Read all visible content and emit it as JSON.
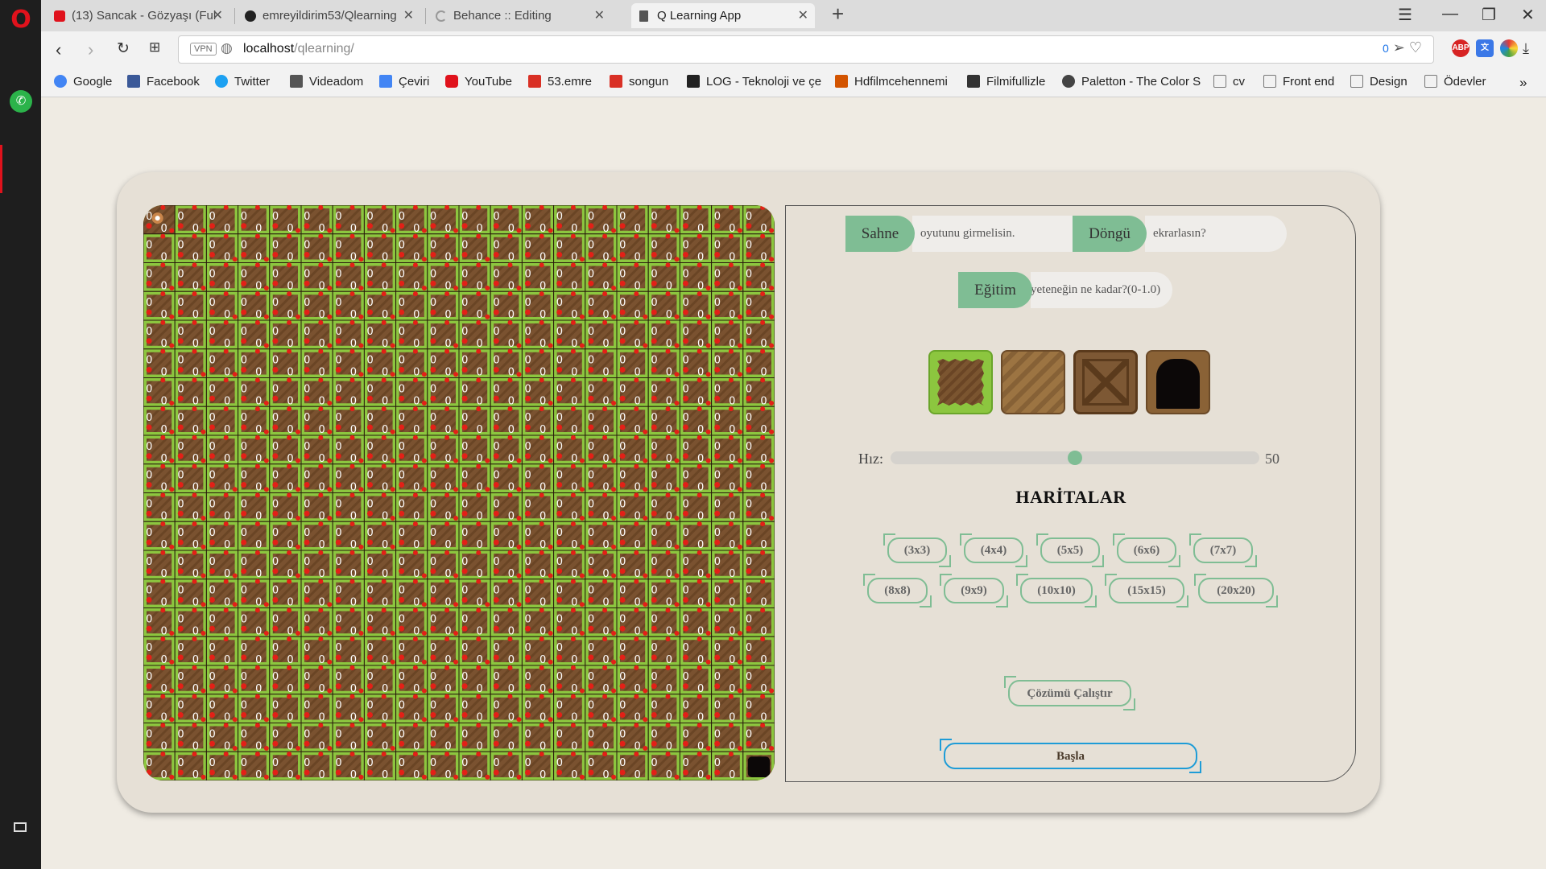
{
  "browser": {
    "tabs": [
      {
        "label": "(13) Sancak - Gözyaşı (Ful",
        "icon": "youtube-icon",
        "color": "#e0121c"
      },
      {
        "label": "emreyildirim53/Qlearning",
        "icon": "github-icon",
        "color": "#222222"
      },
      {
        "label": "Behance :: Editing",
        "icon": "loading-icon",
        "color": "#999999"
      },
      {
        "label": "Q Learning App",
        "icon": "page-icon",
        "color": "#555555"
      }
    ],
    "url_host": "localhost",
    "url_path": "/qlearning/",
    "vpn_label": "VPN",
    "adblock_count": "0",
    "bookmarks": [
      {
        "label": "Google",
        "color": "#4285f4"
      },
      {
        "label": "Facebook",
        "color": "#3b5998"
      },
      {
        "label": "Twitter",
        "color": "#1da1f2"
      },
      {
        "label": "Videadom",
        "color": "#555555"
      },
      {
        "label": "Çeviri",
        "color": "#4285f4"
      },
      {
        "label": "YouTube",
        "color": "#e0121c"
      },
      {
        "label": "53.emre",
        "color": "#d93025"
      },
      {
        "label": "songun",
        "color": "#d93025"
      },
      {
        "label": "LOG - Teknoloji ve çe",
        "color": "#222222"
      },
      {
        "label": "Hdfilmcehennemi",
        "color": "#d35400"
      },
      {
        "label": "Filmifullizle",
        "color": "#333333"
      },
      {
        "label": "Paletton - The Color S",
        "color": "#444444"
      },
      {
        "label": "cv",
        "color": "#777777"
      },
      {
        "label": "Front end",
        "color": "#777777"
      },
      {
        "label": "Design",
        "color": "#777777"
      },
      {
        "label": "Ödevler",
        "color": "#777777"
      }
    ]
  },
  "app": {
    "fields": {
      "sahne": {
        "label": "Sahne",
        "value": "oyutunu girmelisin."
      },
      "dongu": {
        "label": "Döngü",
        "value": "ekrarlasın?"
      },
      "egitim": {
        "label": "Eğitim",
        "value": "yeteneğin ne kadar?(0-1.0)"
      }
    },
    "tiles": [
      "grass-tile",
      "wood-tile",
      "crate-tile",
      "door-tile"
    ],
    "speed": {
      "label": "Hız:",
      "value": 50,
      "min": 0,
      "max": 100
    },
    "maps_title": "HARİTALAR",
    "map_buttons": [
      "(3x3)",
      "(4x4)",
      "(5x5)",
      "(6x6)",
      "(7x7)",
      "(8x8)",
      "(9x9)",
      "(10x10)",
      "(15x15)",
      "(20x20)"
    ],
    "run_solution": "Çözümü Çalıştır",
    "start": "Başla",
    "board": {
      "size": 20,
      "cell_text": "0",
      "colors": {
        "grass": "#8cc63f",
        "dirt": "#7a5230",
        "reward": "#e32017",
        "line": "#2a1a0c"
      }
    }
  }
}
